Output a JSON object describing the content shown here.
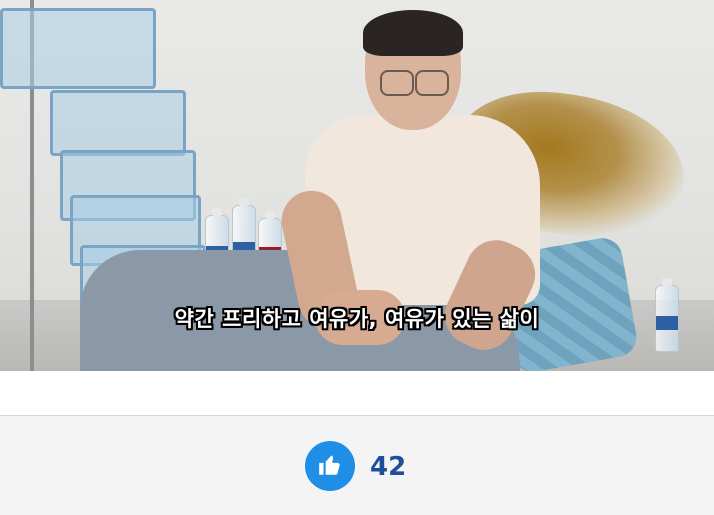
{
  "video": {
    "subtitle": "약간 프리하고 여유가, 여유가 있는 삶이"
  },
  "reactions": {
    "like_icon": "thumbs-up-icon",
    "like_count": "42",
    "accent_color": "#1f8ee6",
    "count_color": "#1f4f9a"
  }
}
